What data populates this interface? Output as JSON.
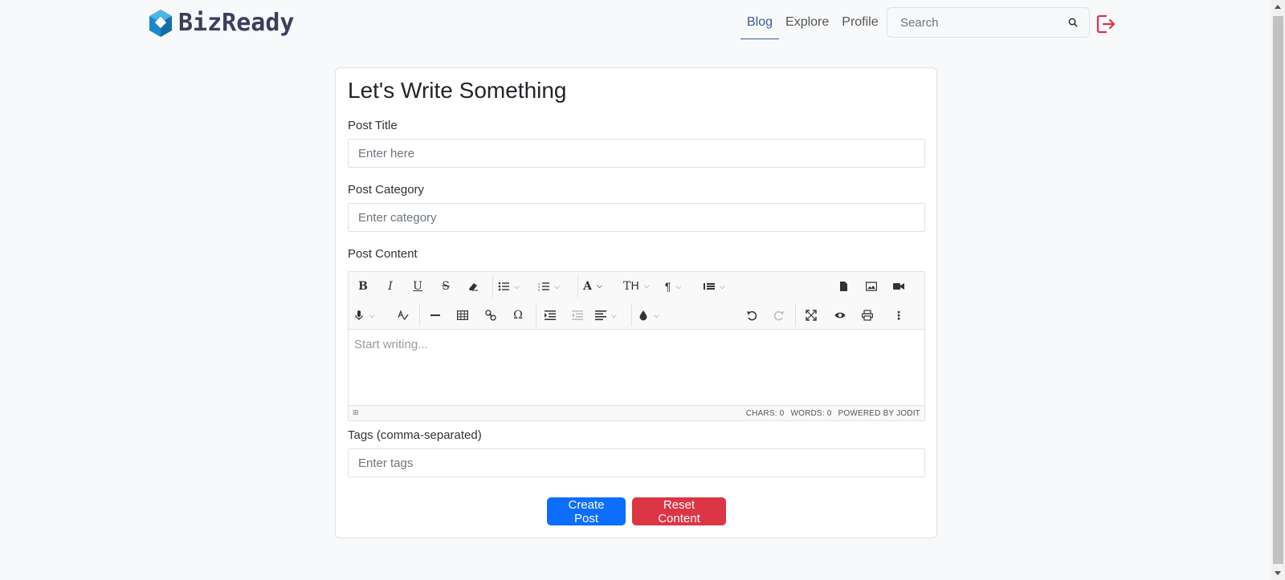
{
  "brand": {
    "name": "BizReady"
  },
  "nav": {
    "links": [
      {
        "label": "Blog",
        "active": true
      },
      {
        "label": "Explore",
        "active": false
      },
      {
        "label": "Profile",
        "active": false
      }
    ],
    "search_placeholder": "Search",
    "icons": {
      "search": "search-icon",
      "logout": "logout-icon"
    }
  },
  "form": {
    "heading": "Let's Write Something",
    "post_title": {
      "label": "Post Title",
      "placeholder": "Enter here"
    },
    "post_category": {
      "label": "Post Category",
      "placeholder": "Enter category"
    },
    "post_content": {
      "label": "Post Content",
      "placeholder": "Start writing...",
      "status": {
        "chars": "CHARS: 0",
        "words": "WORDS: 0",
        "powered": "POWERED BY JODIT"
      }
    },
    "tags": {
      "label": "Tags (comma-separated)",
      "placeholder": "Enter tags"
    },
    "buttons": {
      "create": "Create Post",
      "reset": "Reset Content"
    }
  },
  "colors": {
    "primary": "#0d6efd",
    "danger": "#dc3545",
    "brand": "#1e88c7",
    "nav_active": "#3b5998"
  }
}
